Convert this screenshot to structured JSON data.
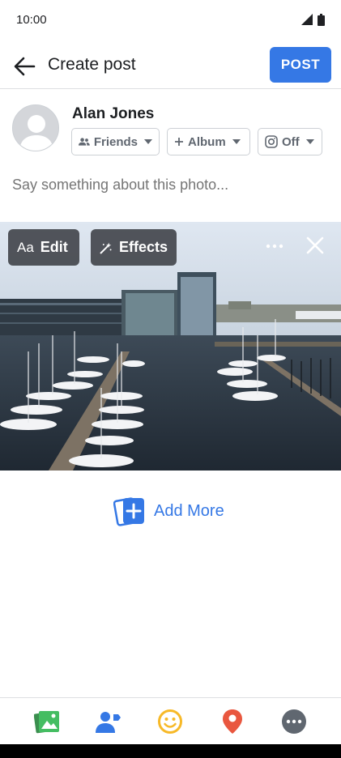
{
  "status_bar": {
    "time": "10:00"
  },
  "header": {
    "title": "Create post",
    "post_label": "POST"
  },
  "user": {
    "name": "Alan Jones"
  },
  "audience": {
    "friends_label": "Friends",
    "album_label": "Album",
    "instagram_label": "Off"
  },
  "composer": {
    "placeholder": "Say something about this photo..."
  },
  "photo_tools": {
    "edit_label": "Edit",
    "edit_icon_text": "Aa",
    "effects_label": "Effects"
  },
  "add_more": {
    "label": "Add More"
  },
  "bottom_bar": {
    "items": [
      "photo-icon",
      "tag-people-icon",
      "feeling-icon",
      "location-icon",
      "more-icon"
    ]
  },
  "colors": {
    "accent": "#3578e5",
    "green": "#45bd62",
    "yellow": "#f7b928",
    "red": "#e9573f",
    "gray": "#606770"
  }
}
